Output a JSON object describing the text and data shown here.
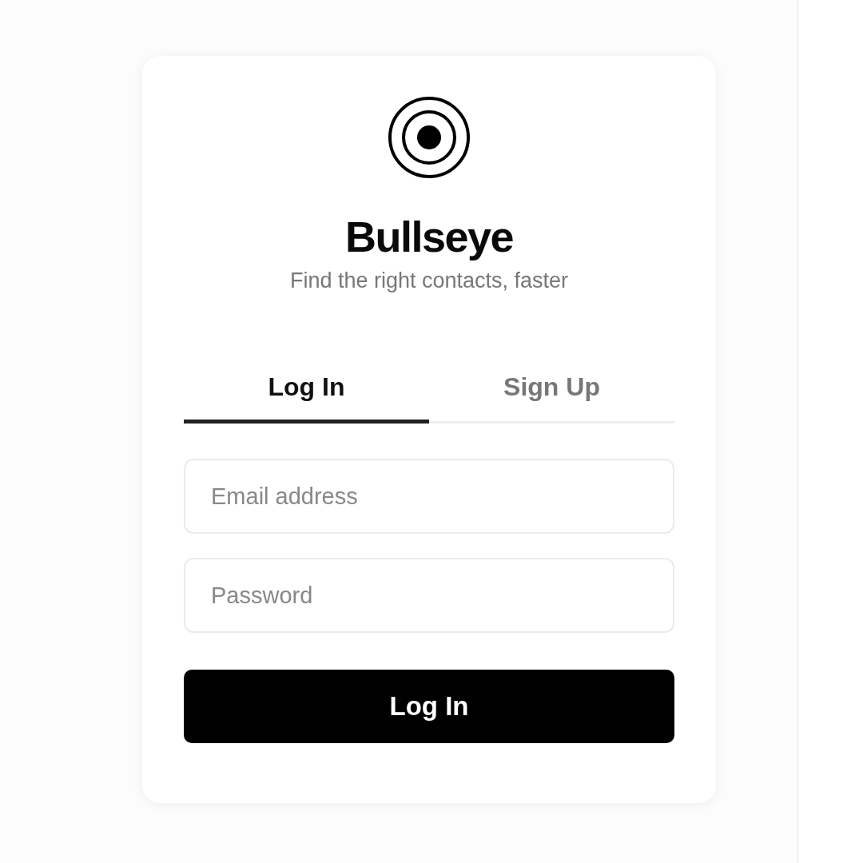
{
  "brand": {
    "title": "Bullseye",
    "subtitle": "Find the right contacts, faster"
  },
  "tabs": [
    {
      "label": "Log In",
      "selected": true
    },
    {
      "label": "Sign Up",
      "selected": false
    }
  ],
  "fields": [
    {
      "placeholder": "Email address"
    },
    {
      "placeholder": "Password"
    }
  ],
  "button": {
    "label": "Log In"
  }
}
